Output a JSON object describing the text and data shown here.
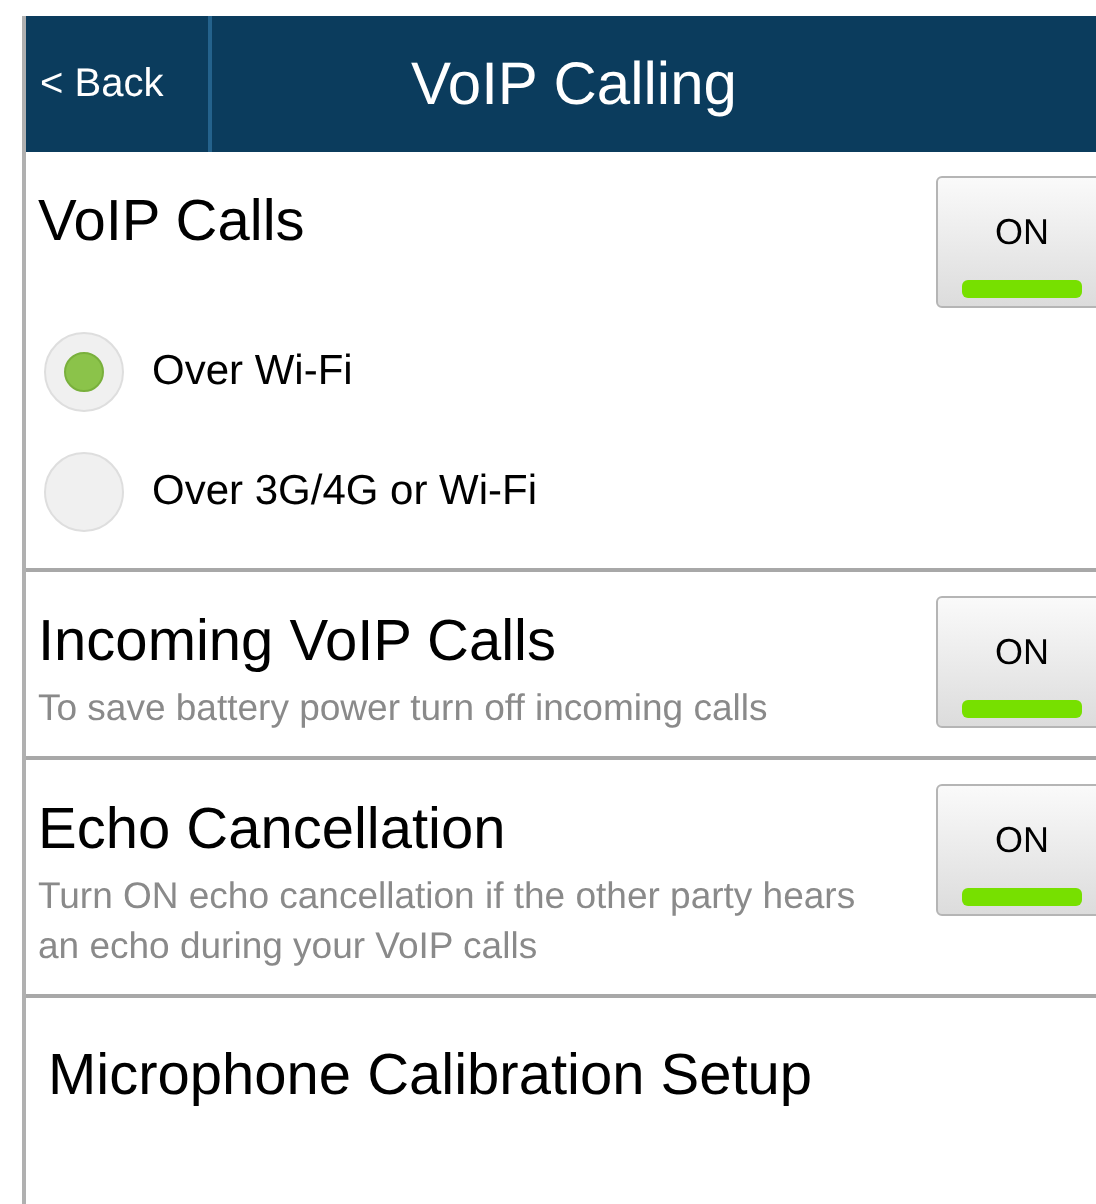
{
  "header": {
    "back": "< Back",
    "title": "VoIP Calling"
  },
  "settings": [
    {
      "kind": "toggle",
      "title": "VoIP Calls",
      "toggle": {
        "label": "ON",
        "on": true
      },
      "options": [
        {
          "label": "Over Wi-Fi",
          "selected": true
        },
        {
          "label": "Over 3G/4G or Wi-Fi",
          "selected": false
        }
      ]
    },
    {
      "kind": "toggle",
      "title": "Incoming VoIP Calls",
      "description": "To save battery power turn off incoming calls",
      "toggle": {
        "label": "ON",
        "on": true
      }
    },
    {
      "kind": "toggle",
      "title": "Echo Cancellation",
      "description": "Turn ON echo cancellation if the other party hears an echo during your VoIP calls",
      "toggle": {
        "label": "ON",
        "on": true
      }
    },
    {
      "kind": "link",
      "title": "Microphone Calibration Setup"
    }
  ]
}
